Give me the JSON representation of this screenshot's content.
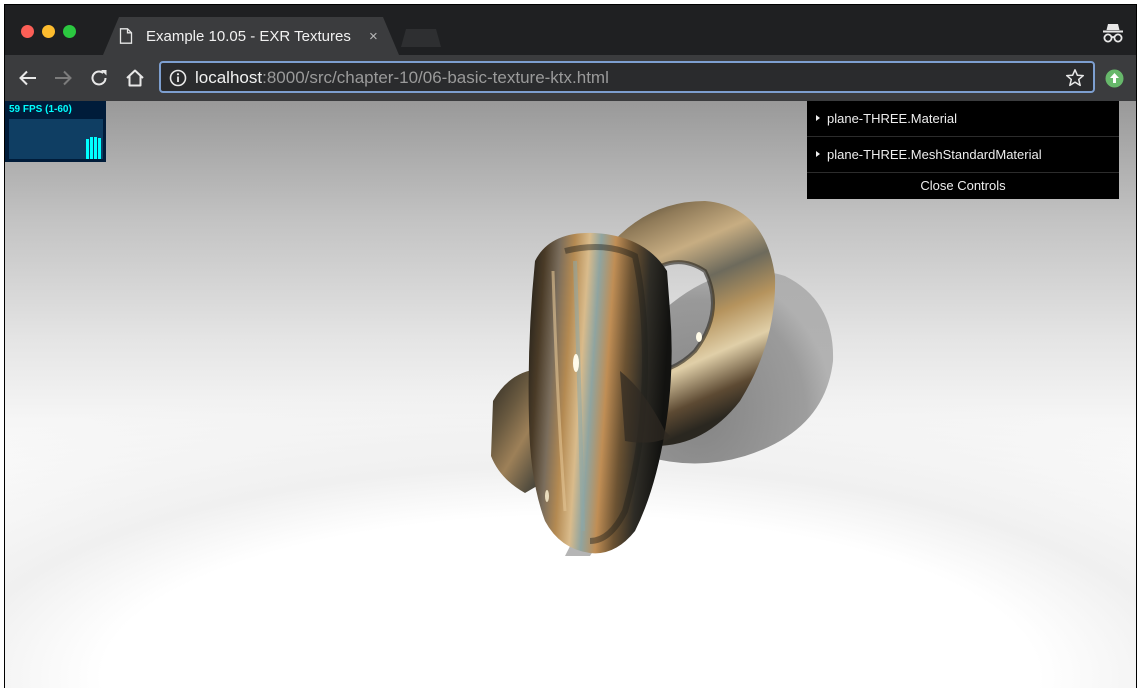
{
  "browser": {
    "tab": {
      "title": "Example 10.05 - EXR Textures",
      "close_glyph": "×"
    },
    "address_bar": {
      "host": "localhost",
      "rest": ":8000/src/chapter-10/06-basic-texture-ktx.html"
    },
    "icons": {
      "tab": "page-icon",
      "back": "arrow-left-icon",
      "forward": "arrow-right-icon",
      "reload": "reload-icon",
      "home": "home-icon",
      "info": "info-icon",
      "bookmark": "star-icon",
      "incognito": "incognito-icon",
      "extension": "update-arrow-icon"
    }
  },
  "stats": {
    "fps_label": "59 FPS (1-60)",
    "colors": {
      "text": "#00ffff",
      "bg": "#001c3a",
      "graph_bg": "#0f3e63"
    }
  },
  "gui": {
    "folders": [
      {
        "label": "plane-THREE.Material"
      },
      {
        "label": "plane-THREE.MeshStandardMaterial"
      }
    ],
    "close_label": "Close Controls"
  },
  "scene": {
    "object": "torus-knot",
    "texture_colors": [
      "#2d2a22",
      "#6b5636",
      "#b08650",
      "#d7b98a",
      "#5e7575",
      "#9aa7a0"
    ],
    "accent": "#7d9fd0"
  }
}
